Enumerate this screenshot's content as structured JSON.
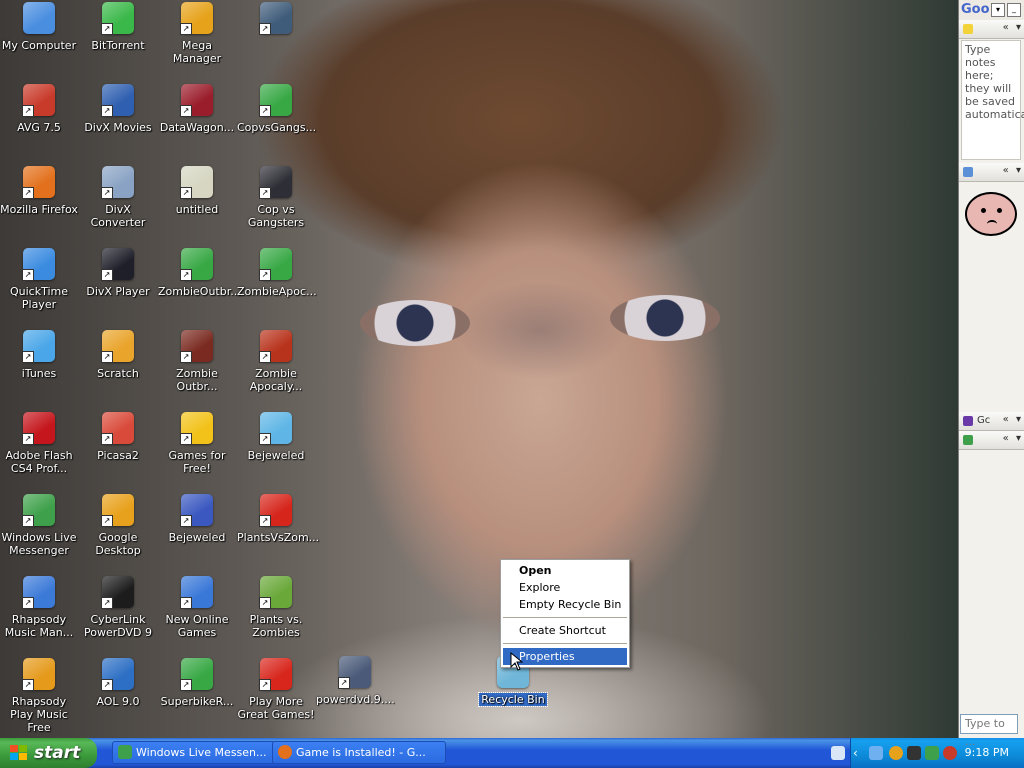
{
  "desktop": {
    "icons": [
      {
        "label": "My Computer",
        "color": "#4a8ee0"
      },
      {
        "label": "BitTorrent",
        "color": "#3bb84a"
      },
      {
        "label": "Mega Manager",
        "color": "#e6a21a"
      },
      {
        "label": "",
        "color": "#3f5c7a"
      },
      {
        "label": "AVG 7.5",
        "color": "#c83a2a"
      },
      {
        "label": "DivX Movies",
        "color": "#2f5fb0"
      },
      {
        "label": "DataWagon...",
        "color": "#9a1d2b"
      },
      {
        "label": "CopvsGangs...",
        "color": "#38a845"
      },
      {
        "label": "Mozilla Firefox",
        "color": "#e2701c"
      },
      {
        "label": "DivX Converter",
        "color": "#8aa3c4"
      },
      {
        "label": "untitled",
        "color": "#d6d6c2"
      },
      {
        "label": "Cop vs Gangsters",
        "color": "#2e2e36"
      },
      {
        "label": "QuickTime Player",
        "color": "#3b8be0"
      },
      {
        "label": "DivX Player",
        "color": "#1f1f2a"
      },
      {
        "label": "ZombieOutbr...",
        "color": "#38a845"
      },
      {
        "label": "ZombieApoc...",
        "color": "#38a845"
      },
      {
        "label": "iTunes",
        "color": "#4aa6e8"
      },
      {
        "label": "Scratch",
        "color": "#e9a42b"
      },
      {
        "label": "Zombie Outbr...",
        "color": "#7a2a20"
      },
      {
        "label": "Zombie Apocaly...",
        "color": "#b8331c"
      },
      {
        "label": "Adobe Flash CS4 Prof...",
        "color": "#c4161c"
      },
      {
        "label": "Picasa2",
        "color": "#d94a3a"
      },
      {
        "label": "Games for Free!",
        "color": "#f2c21a"
      },
      {
        "label": "Bejeweled",
        "color": "#5fb6e6"
      },
      {
        "label": "Windows Live Messenger",
        "color": "#3ea04a"
      },
      {
        "label": "Google Desktop",
        "color": "#e8a11c"
      },
      {
        "label": "Bejeweled",
        "color": "#3a58c0"
      },
      {
        "label": "PlantsVsZom...",
        "color": "#d6261c"
      },
      {
        "label": "Rhapsody Music Man...",
        "color": "#3c7ad8"
      },
      {
        "label": "CyberLink PowerDVD 9",
        "color": "#1c1c1c"
      },
      {
        "label": "New Online Games",
        "color": "#3a78d8"
      },
      {
        "label": "Plants vs. Zombies",
        "color": "#6aa83a"
      },
      {
        "label": "Rhapsody Play Music Free",
        "color": "#e59a1c"
      },
      {
        "label": "AOL 9.0",
        "color": "#2d6fc4"
      },
      {
        "label": "SuperbikeR...",
        "color": "#38a845"
      },
      {
        "label": "Play More Great Games!",
        "color": "#d8261c"
      },
      {
        "label": "powerdvd.9....",
        "color": "#4a5a78"
      },
      {
        "label": "Recycle Bin",
        "color": "#6fb6d8"
      }
    ]
  },
  "context_menu": {
    "items": [
      "Open",
      "Explore",
      "Empty Recycle Bin",
      "Create Shortcut",
      "Properties"
    ]
  },
  "taskbar": {
    "start_label": "start",
    "tasks": [
      {
        "label": "Windows Live Messen...",
        "color": "#3ea04a"
      },
      {
        "label": "Game is Installed! - G...",
        "color": "#e2701c"
      }
    ],
    "clock": "9:18 PM"
  },
  "sidebar": {
    "logo": "Goo",
    "notes_placeholder": "Type notes here; they will be saved automatically.",
    "news_label": "Gc",
    "search_placeholder": "Type to ..."
  }
}
